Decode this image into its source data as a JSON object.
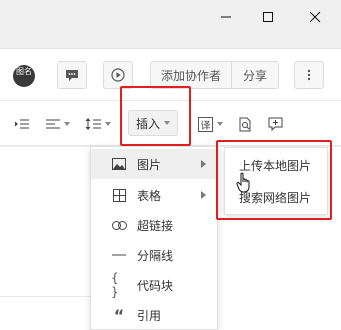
{
  "window": {
    "controls": [
      "minimize-icon",
      "maximize-icon",
      "close-icon"
    ]
  },
  "header": {
    "avatar_text": "图名",
    "add_collaborator_label": "添加协作者",
    "share_label": "分享"
  },
  "format_toolbar": {
    "insert_label": "插入",
    "translate_icon_text": "译"
  },
  "insert_menu": {
    "items": [
      {
        "label": "图片",
        "icon": "image-icon",
        "has_submenu": true,
        "active": true
      },
      {
        "label": "表格",
        "icon": "table-icon",
        "has_submenu": true
      },
      {
        "label": "超链接",
        "icon": "link-icon"
      },
      {
        "label": "分隔线",
        "icon": "divider-icon"
      },
      {
        "label": "代码块",
        "icon": "code-block-icon",
        "glyph": "{ }"
      },
      {
        "label": "引用",
        "icon": "quote-icon",
        "glyph": "“"
      }
    ]
  },
  "image_submenu": {
    "items": [
      {
        "label": "上传本地图片"
      },
      {
        "label": "搜索网络图片"
      }
    ]
  },
  "colors": {
    "highlight": "#e02020",
    "menu_active": "#efefef"
  }
}
